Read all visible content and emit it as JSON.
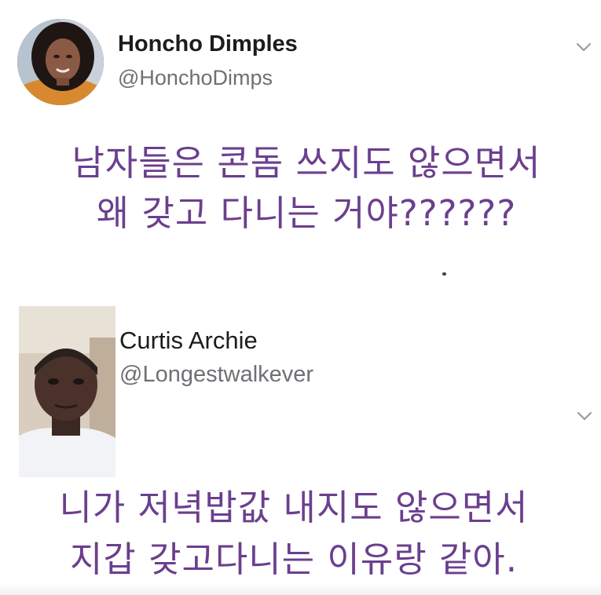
{
  "tweets": [
    {
      "name": "Honcho Dimples",
      "handle": "@HonchoDimps",
      "text_lines": [
        "남자들은 콘돔 쓰지도 않으면서",
        "왜 갖고 다니는 거야??????"
      ]
    },
    {
      "name": "Curtis Archie",
      "handle": "@Longestwalkever",
      "text_lines": [
        "니가 저녁밥값 내지도 않으면서",
        "지갑 갖고다니는 이유랑 같아."
      ]
    }
  ],
  "colors": {
    "tweet_text": "#6b3f8e",
    "name": "#1c1c1c",
    "handle": "#6f6f75",
    "chevron": "#9a9aa2"
  },
  "icons": {
    "menu_chevron": "chevron-down-icon"
  }
}
